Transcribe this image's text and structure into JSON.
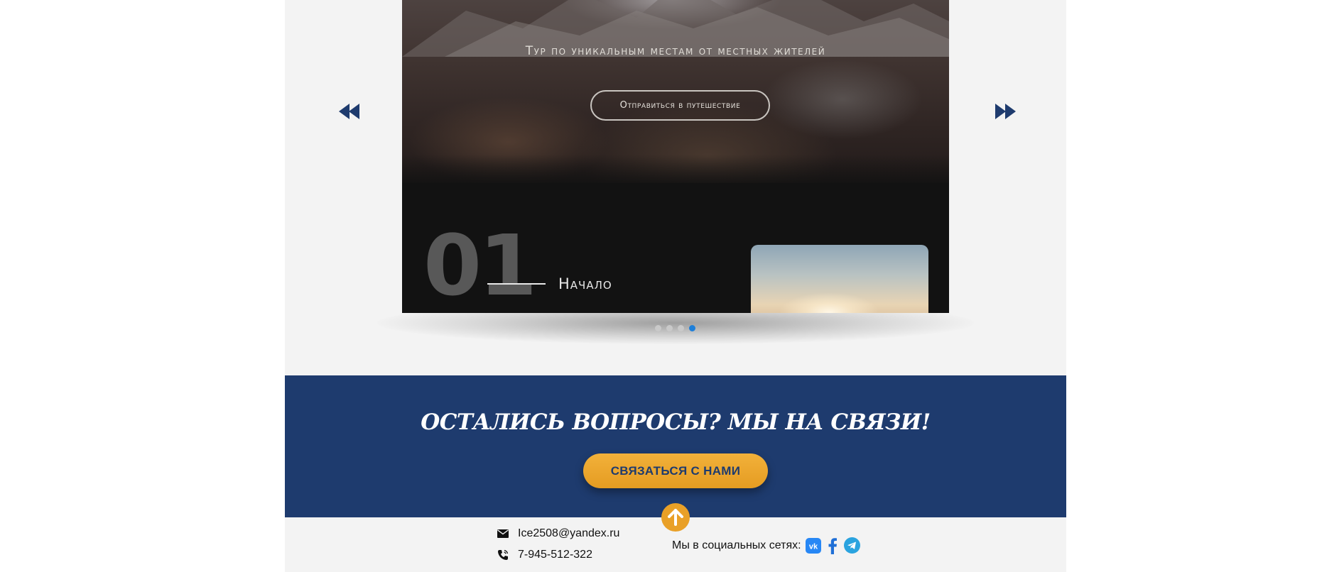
{
  "slider": {
    "slide": {
      "subtitle": "Тур по уникальным местам от местных жителей",
      "cta_label": "Отправиться в путешествие",
      "number": "01",
      "section_label": "Начало"
    },
    "prev_icon": "double-chevron-left-icon",
    "next_icon": "double-chevron-right-icon",
    "dots": {
      "count": 4,
      "active_index": 3
    }
  },
  "contact_band": {
    "title": "ОСТАЛИСЬ ВОПРОСЫ? МЫ НА СВЯЗИ!",
    "button_label": "СВЯЗАТЬСЯ С НАМИ",
    "up_icon": "arrow-up-icon"
  },
  "footer": {
    "email": "Ice2508@yandex.ru",
    "phone": "7-945-512-322",
    "social_label": "Мы в социальных сетях:",
    "social_icons": [
      "vk-icon",
      "facebook-icon",
      "telegram-icon"
    ]
  },
  "colors": {
    "band_background": "#1e3b6e",
    "accent_orange": "#e9a027",
    "arrow_color": "#1e3b6e",
    "active_dot": "#1e7fd9",
    "inactive_dot": "#c9c9c9",
    "page_background": "#f3f3f3"
  }
}
